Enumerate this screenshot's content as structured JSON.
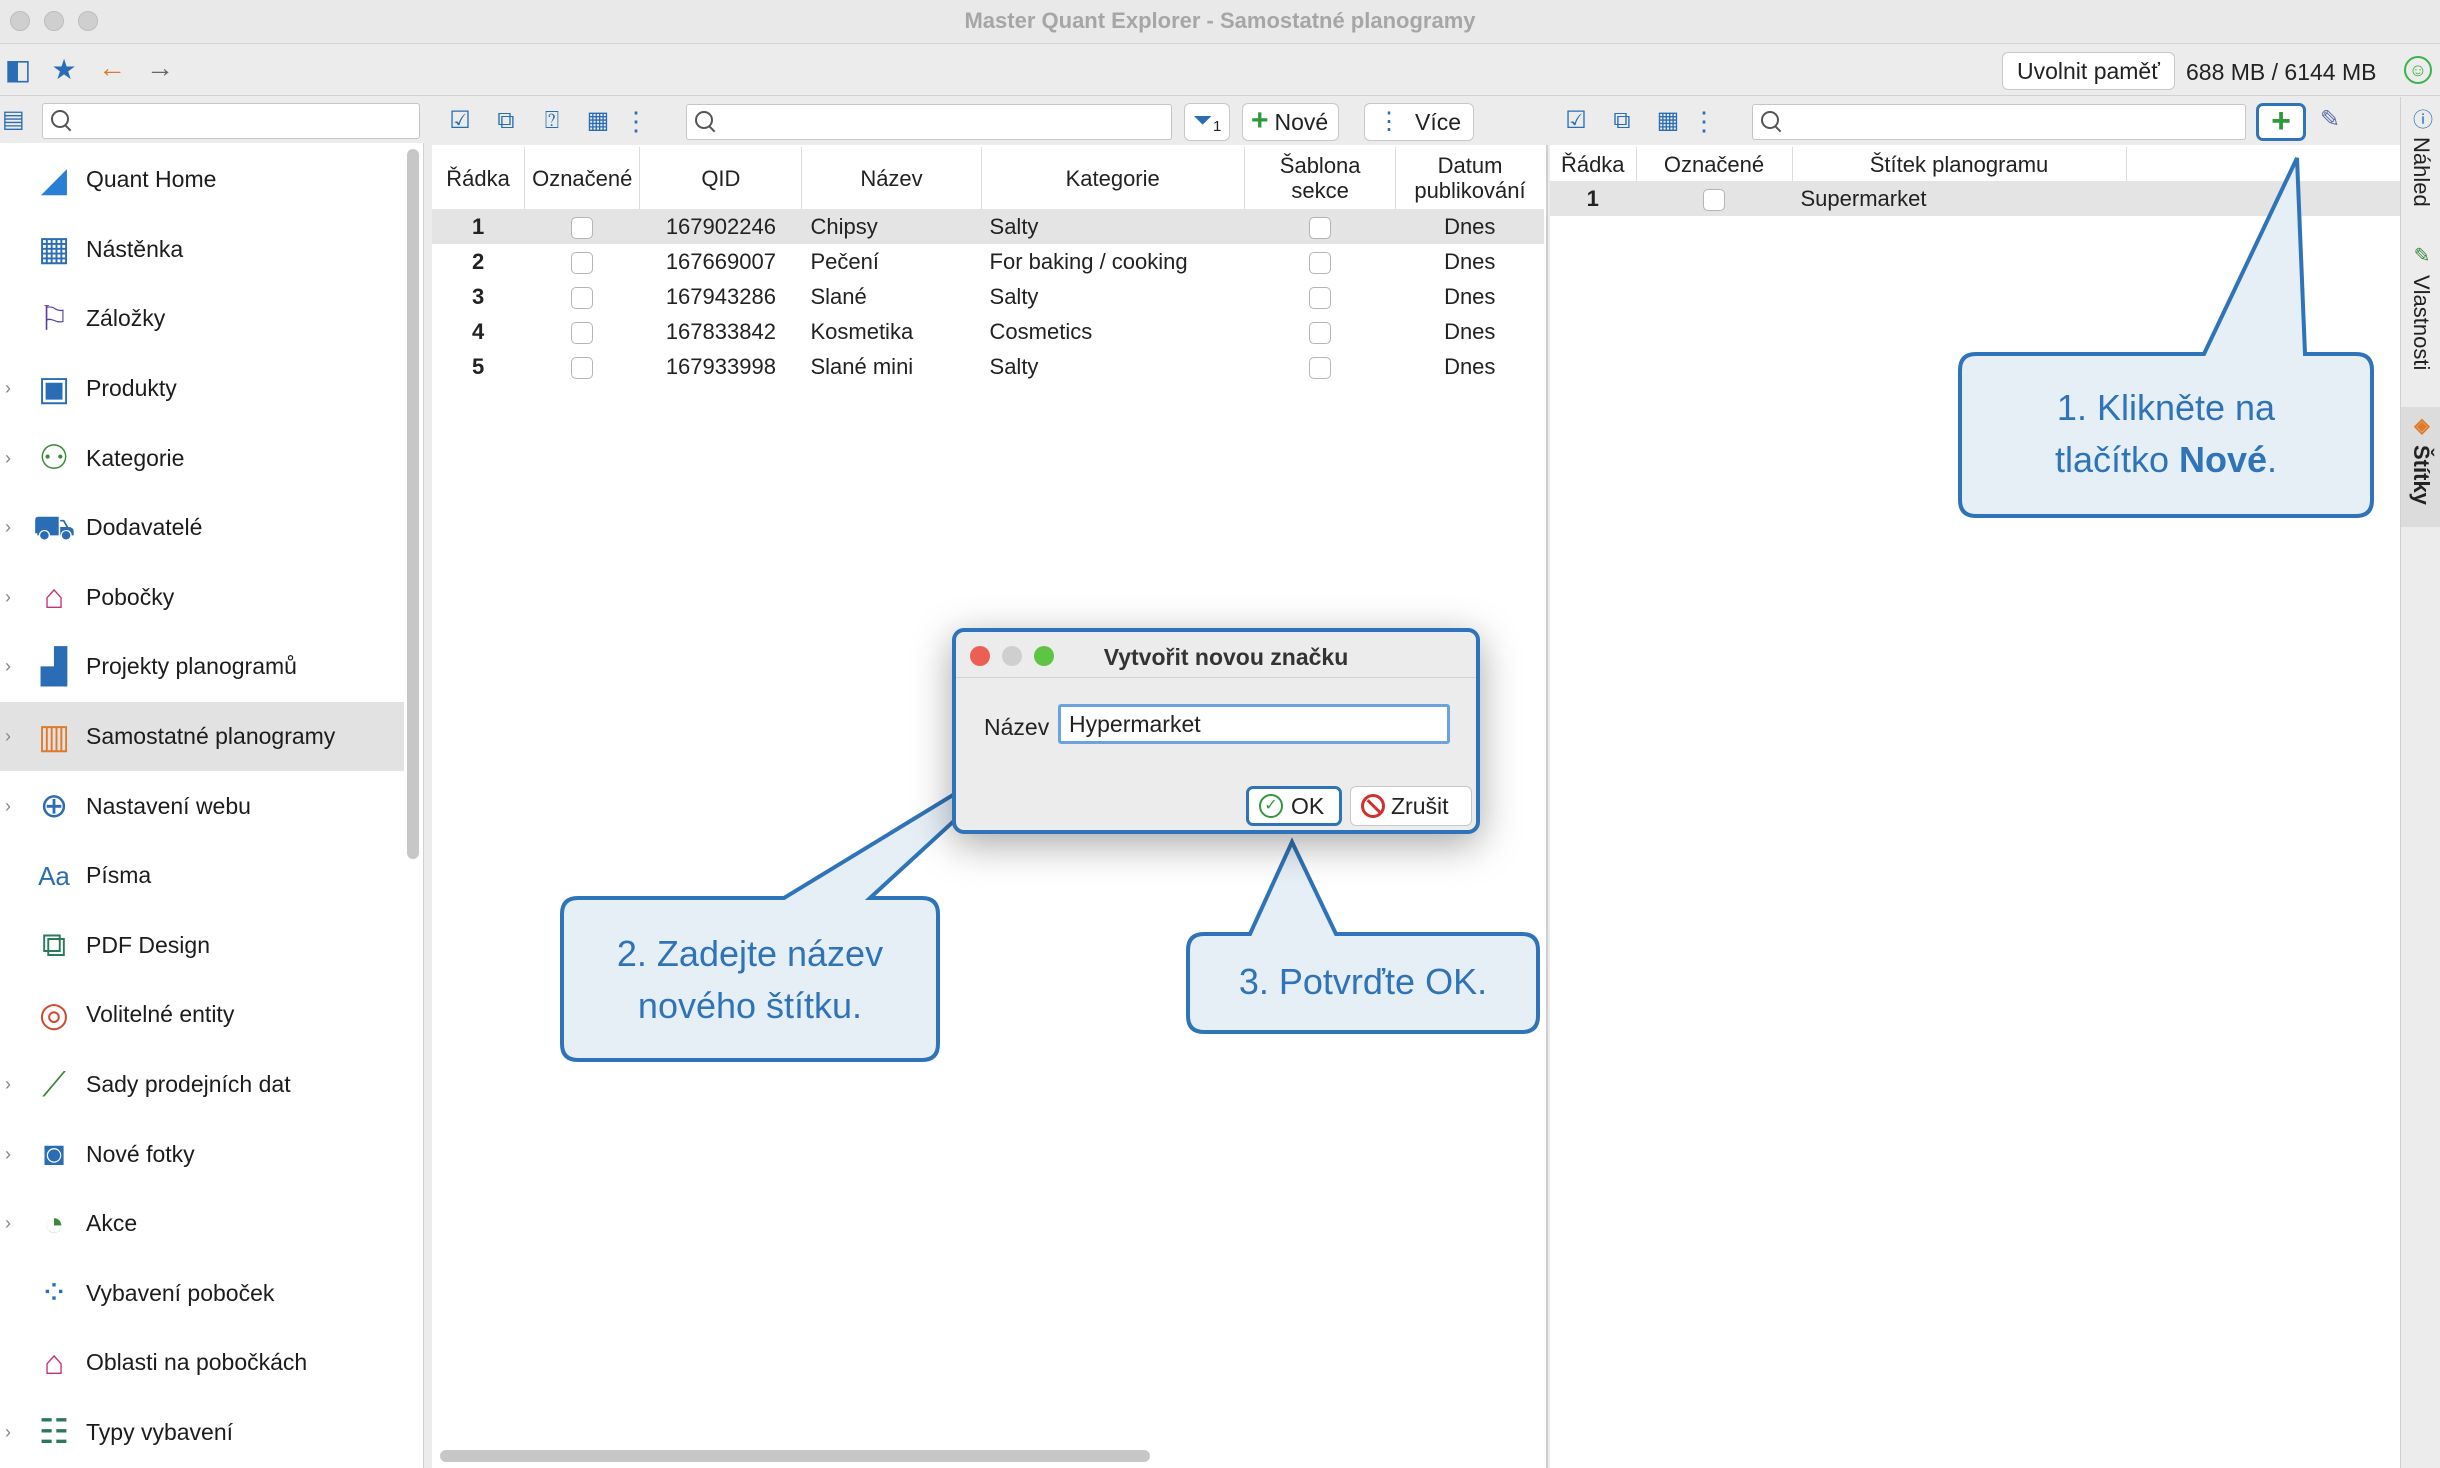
{
  "window": {
    "title": "Master Quant Explorer - Samostatné planogramy"
  },
  "toolbar": {
    "memory_button": "Uvolnit paměť",
    "memory_text": "688 MB / 6144 MB"
  },
  "nav": {
    "items": [
      {
        "label": "Quant Home",
        "icon": "quant-home-icon",
        "glyph": "◢",
        "color": "#2a7fd4",
        "expandable": false
      },
      {
        "label": "Nástěnka",
        "icon": "dashboard-icon",
        "glyph": "▦",
        "color": "#2a6db5",
        "expandable": false
      },
      {
        "label": "Záložky",
        "icon": "bookmark-icon",
        "glyph": "⚐",
        "color": "#5a3fa0",
        "expandable": false
      },
      {
        "label": "Produkty",
        "icon": "product-icon",
        "glyph": "▣",
        "color": "#2a6db5",
        "expandable": true
      },
      {
        "label": "Kategorie",
        "icon": "category-tree-icon",
        "glyph": "⚇",
        "color": "#3a8a3a",
        "expandable": true
      },
      {
        "label": "Dodavatelé",
        "icon": "supplier-truck-icon",
        "glyph": "⛟",
        "color": "#2a6db5",
        "expandable": true
      },
      {
        "label": "Pobočky",
        "icon": "store-icon",
        "glyph": "⌂",
        "color": "#c2307a",
        "expandable": true
      },
      {
        "label": "Projekty planogramů",
        "icon": "planogram-project-icon",
        "glyph": "▟",
        "color": "#2a6db5",
        "expandable": true
      },
      {
        "label": "Samostatné planogramy",
        "icon": "planogram-icon",
        "glyph": "▥",
        "color": "#e07a2a",
        "expandable": true,
        "selected": true
      },
      {
        "label": "Nastavení webu",
        "icon": "web-settings-icon",
        "glyph": "⊕",
        "color": "#2a6db5",
        "expandable": true
      },
      {
        "label": "Písma",
        "icon": "fonts-icon",
        "glyph": "Aa",
        "color": "#2a6db5",
        "expandable": false
      },
      {
        "label": "PDF Design",
        "icon": "pdf-design-icon",
        "glyph": "⧉",
        "color": "#2a7a5a",
        "expandable": false
      },
      {
        "label": "Volitelné entity",
        "icon": "custom-entities-icon",
        "glyph": "◎",
        "color": "#d04a30",
        "expandable": false
      },
      {
        "label": "Sady prodejních dat",
        "icon": "sales-data-icon",
        "glyph": "⟋",
        "color": "#3a8a3a",
        "expandable": true
      },
      {
        "label": "Nové fotky",
        "icon": "camera-icon",
        "glyph": "◙",
        "color": "#2a6db5",
        "expandable": true
      },
      {
        "label": "Akce",
        "icon": "promotion-icon",
        "glyph": "◔",
        "color": "#3a8a3a",
        "expandable": true
      },
      {
        "label": "Vybavení poboček",
        "icon": "store-equipment-icon",
        "glyph": "⁘",
        "color": "#2a6db5",
        "expandable": false
      },
      {
        "label": "Oblasti na pobočkách",
        "icon": "store-area-icon",
        "glyph": "⌂",
        "color": "#c2307a",
        "expandable": false
      },
      {
        "label": "Typy vybavení",
        "icon": "equipment-types-icon",
        "glyph": "☷",
        "color": "#2a7a5a",
        "expandable": true
      }
    ]
  },
  "middle": {
    "filter_count": "1",
    "new_button": "Nové",
    "more_button": "Více",
    "columns": [
      "Řádka",
      "Označené",
      "QID",
      "Název",
      "Kategorie",
      "Šablona sekce",
      "Datum publikování"
    ],
    "columns_multiline": {
      "template_line1": "Šablona",
      "template_line2": "sekce",
      "date_line1": "Datum",
      "date_line2": "publikování"
    },
    "rows": [
      {
        "row": "1",
        "qid": "167902246",
        "name": "Chipsy",
        "category": "Salty",
        "date": "Dnes"
      },
      {
        "row": "2",
        "qid": "167669007",
        "name": "Pečení",
        "category": "For baking / cooking",
        "date": "Dnes"
      },
      {
        "row": "3",
        "qid": "167943286",
        "name": "Slané",
        "category": "Salty",
        "date": "Dnes"
      },
      {
        "row": "4",
        "qid": "167833842",
        "name": "Kosmetika",
        "category": "Cosmetics",
        "date": "Dnes"
      },
      {
        "row": "5",
        "qid": "167933998",
        "name": "Slané mini",
        "category": "Salty",
        "date": "Dnes"
      }
    ]
  },
  "right": {
    "columns": [
      "Řádka",
      "Označené",
      "Štítek planogramu"
    ],
    "rows": [
      {
        "row": "1",
        "label": "Supermarket"
      }
    ]
  },
  "side_tabs": [
    "Náhled",
    "Vlastnosti",
    "Štítky"
  ],
  "dialog": {
    "title": "Vytvořit novou značku",
    "label": "Název",
    "value": "Hypermarket",
    "ok": "OK",
    "cancel": "Zrušit"
  },
  "callouts": {
    "step1_line1": "1. Klikněte na",
    "step1_line2_prefix": "tlačítko ",
    "step1_line2_bold": "Nové",
    "step1_line2_suffix": ".",
    "step2_line1": "2. Zadejte název",
    "step2_line2": "nového štítku.",
    "step3": "3. Potvrďte OK."
  },
  "colors": {
    "accent": "#2f73b8",
    "callout_fill": "#e6eef6",
    "selected_row": "#e4e4e4"
  }
}
